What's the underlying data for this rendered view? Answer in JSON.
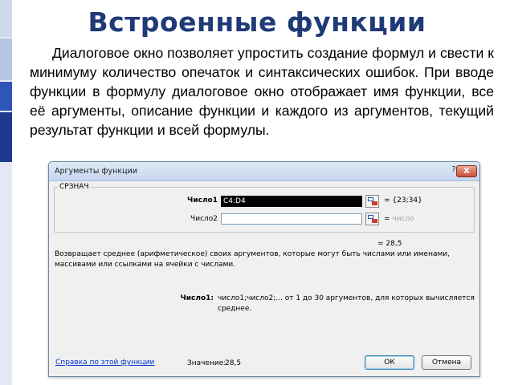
{
  "slide": {
    "title": "Встроенные функции",
    "paragraph": "Диалоговое окно позволяет упростить создание формул и свести к минимуму количество опечаток и синтаксических ошибок. При вводе функции в формулу диалоговое окно отображает имя функции, все её аргументы, описание функции и каждого из аргументов, текущий результат функции и всей формулы."
  },
  "dialog": {
    "title": "Аргументы функции",
    "help_glyph": "?",
    "close_glyph": "X",
    "function_name": "СРЗНАЧ",
    "args": [
      {
        "label": "Число1",
        "value": "C4:D4",
        "result": "{23;34}"
      },
      {
        "label": "Число2",
        "value": "",
        "result": "число"
      }
    ],
    "equals": "=",
    "function_result": "= 28,5",
    "description": "Возвращает среднее (арифметическое) своих аргументов, которые могут быть числами или именами, массивами или ссылками на ячейки с числами.",
    "arg_help_label": "Число1:",
    "arg_help_text": "число1;число2;... от 1 до 30 аргументов, для которых вычисляется среднее.",
    "help_link": "Справка по этой функции",
    "value_label": "Значение:",
    "value": "28,5",
    "ok_label": "ОК",
    "cancel_label": "Отмена"
  },
  "colors": {
    "title": "#1f3a77",
    "link": "#0033cc",
    "accent_stripe": "#2f56b7"
  }
}
